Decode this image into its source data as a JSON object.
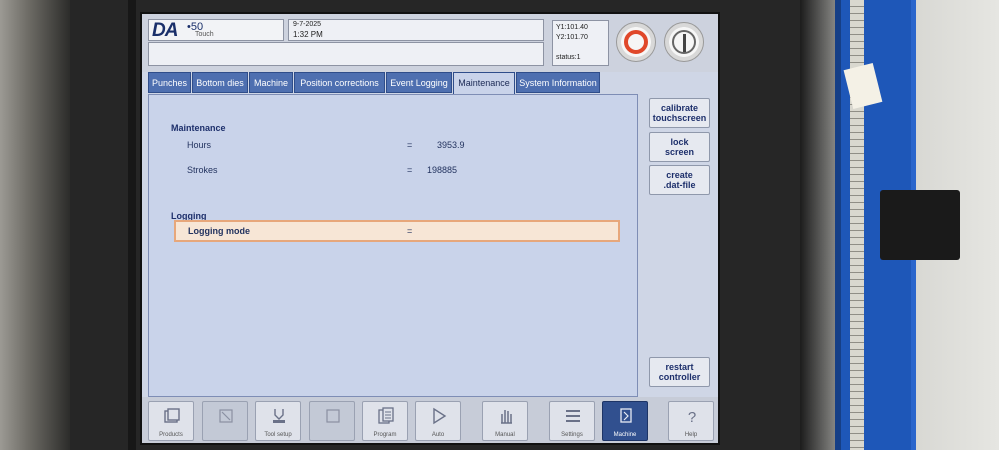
{
  "header": {
    "logo_model": "50",
    "logo_sub": "Touch",
    "date": "9-7-2025",
    "time": "1:32 PM",
    "axes": [
      "Y1:101.40",
      "Y2:101.70",
      "status:1"
    ]
  },
  "tabs": [
    {
      "label": "Punches",
      "active": false
    },
    {
      "label": "Bottom dies",
      "active": false
    },
    {
      "label": "Machine",
      "active": false
    },
    {
      "label": "Position corrections",
      "active": false
    },
    {
      "label": "Event Logging",
      "active": false
    },
    {
      "label": "Maintenance",
      "active": true
    },
    {
      "label": "System Information",
      "active": false
    }
  ],
  "maintenance": {
    "title": "Maintenance",
    "hours_label": "Hours",
    "hours_eq": "=",
    "hours_value": "3953.9",
    "strokes_label": "Strokes",
    "strokes_eq": "=",
    "strokes_value": "198885"
  },
  "logging": {
    "title": "Logging",
    "mode_label": "Logging mode",
    "mode_eq": "=",
    "mode_value": ""
  },
  "side_buttons": {
    "calibrate": [
      "calibrate",
      "touchscreen"
    ],
    "lock": [
      "lock",
      "screen"
    ],
    "create": [
      "create",
      ".dat-file"
    ],
    "restart": [
      "restart",
      "controller"
    ]
  },
  "nav": [
    {
      "label": "Products",
      "icon": "products-icon"
    },
    {
      "label": "",
      "icon": "blank-icon"
    },
    {
      "label": "Tool setup",
      "icon": "tool-setup-icon"
    },
    {
      "label": "",
      "icon": "blank-icon"
    },
    {
      "label": "Program",
      "icon": "program-icon"
    },
    {
      "label": "Auto",
      "icon": "play-icon"
    },
    {
      "label": "Manual",
      "icon": "hand-icon"
    },
    {
      "label": "Settings",
      "icon": "settings-icon"
    },
    {
      "label": "Machine",
      "icon": "machine-icon"
    },
    {
      "label": "Help",
      "icon": "help-icon"
    }
  ],
  "colors": {
    "tab": "#4e6fb0",
    "active_tab": "#c9d3ea",
    "selected_row": "#f7e6d6",
    "stop_ring": "#e0482a"
  }
}
